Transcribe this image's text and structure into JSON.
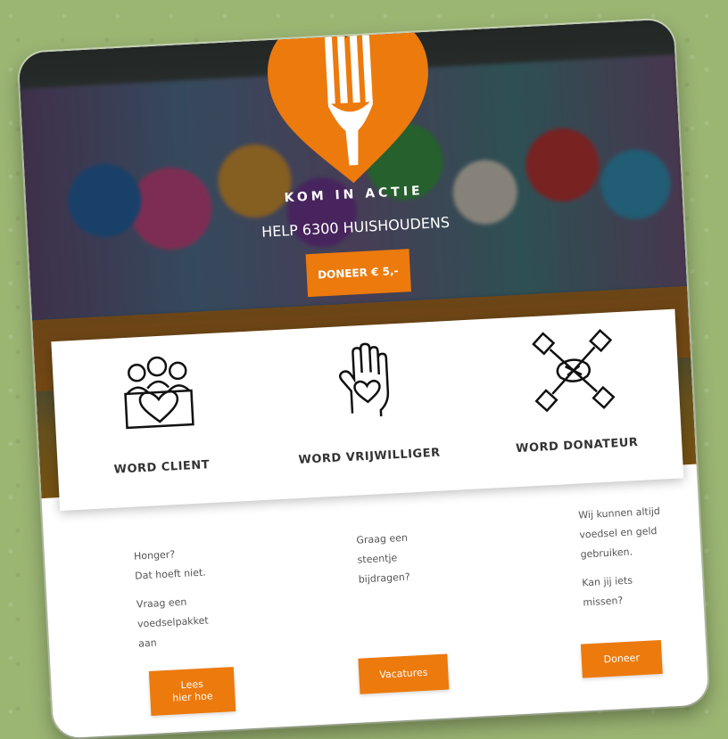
{
  "hero": {
    "heading": "KOM IN ACTIE",
    "subheading": "HELP 6300 HUISHOUDENS",
    "donate_button": "DONEER € 5,-"
  },
  "actions": [
    {
      "label": "WORD CLIENT",
      "icon": "people-heart-box-icon"
    },
    {
      "label": "WORD VRIJWILLIGER",
      "icon": "hand-heart-icon"
    },
    {
      "label": "WORD DONATEUR",
      "icon": "hands-stacked-icon"
    }
  ],
  "details": [
    {
      "paragraphs": [
        "Honger?",
        "Dat hoeft niet.",
        "Vraag een voedselpakket aan"
      ],
      "button": [
        "Lees",
        "hier hoe"
      ]
    },
    {
      "paragraphs": [
        "Graag een steentje bijdragen?"
      ],
      "button": [
        "Vacatures"
      ]
    },
    {
      "paragraphs": [
        "Wij kunnen altijd voedsel en geld gebruiken.",
        "Kan jij iets missen?"
      ],
      "button": [
        "Doneer"
      ]
    }
  ],
  "colors": {
    "accent": "#ec7a0d",
    "background": "#9bb573"
  }
}
